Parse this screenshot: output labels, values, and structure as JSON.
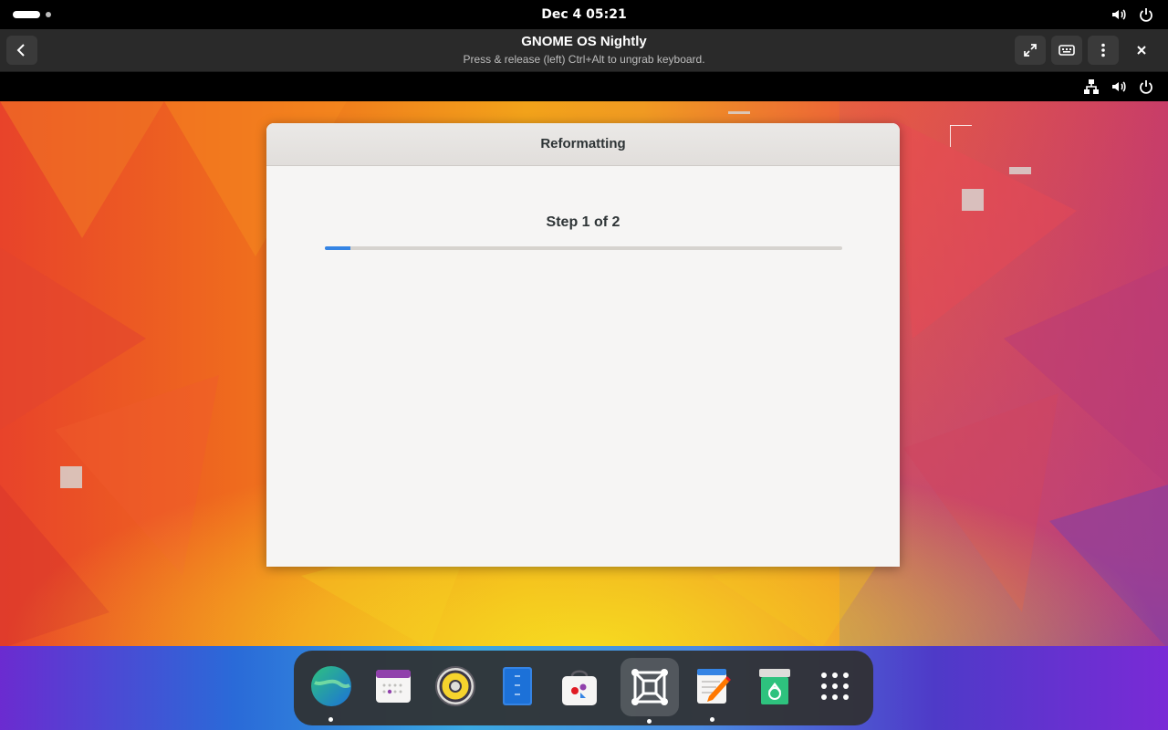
{
  "host_topbar": {
    "clock": "Dec 4  05:21",
    "status_icons": [
      "volume-icon",
      "power-icon"
    ]
  },
  "vm_header": {
    "title": "GNOME OS Nightly",
    "subtitle": "Press & release (left) Ctrl+Alt to ungrab keyboard.",
    "buttons": [
      "back-icon",
      "fullscreen-icon",
      "keyboard-icon",
      "menu-icon",
      "close-icon"
    ]
  },
  "guest_topbar": {
    "status_icons": [
      "network-icon",
      "volume-icon",
      "power-icon"
    ]
  },
  "dialog": {
    "title": "Reformatting",
    "step": "Step 1 of 2",
    "progress": 0.05
  },
  "dock": {
    "items": [
      {
        "name": "web-browser",
        "running": true
      },
      {
        "name": "calendar",
        "running": false
      },
      {
        "name": "rhythmbox-speaker",
        "running": false
      },
      {
        "name": "files",
        "running": false
      },
      {
        "name": "software",
        "running": false
      },
      {
        "name": "boxes",
        "running": true,
        "active": true
      },
      {
        "name": "text-editor",
        "running": true
      },
      {
        "name": "trash",
        "running": false
      },
      {
        "name": "app-grid",
        "running": false
      }
    ]
  },
  "colors": {
    "accent": "#3584e4",
    "dialog_bg": "#f6f5f4"
  }
}
